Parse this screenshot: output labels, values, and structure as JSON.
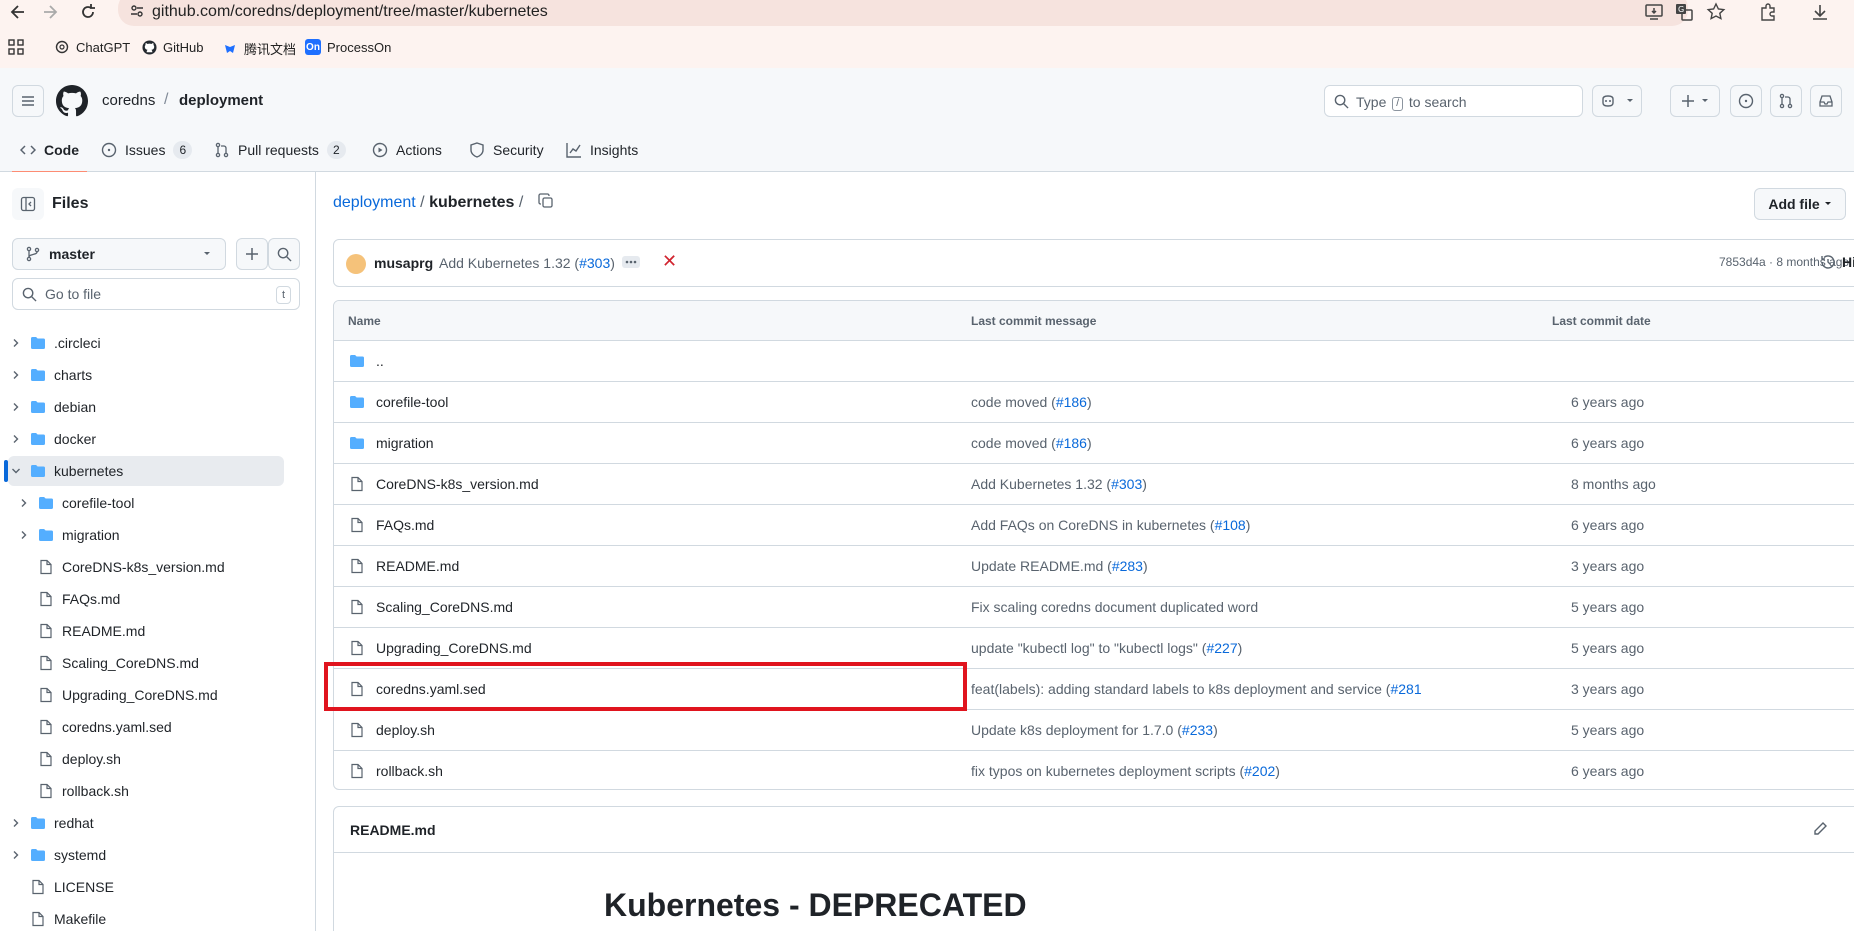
{
  "browser": {
    "url": "github.com/coredns/deployment/tree/master/kubernetes",
    "bookmarks": [
      {
        "label": "ChatGPT"
      },
      {
        "label": "GitHub"
      },
      {
        "label": "腾讯文档"
      },
      {
        "label": "ProcessOn"
      }
    ]
  },
  "header": {
    "owner": "coredns",
    "separator": "/",
    "repo": "deployment",
    "search_type": "Type",
    "search_slash": "/",
    "search_rest": "to search"
  },
  "tabs": [
    {
      "label": "Code"
    },
    {
      "label": "Issues",
      "count": "6"
    },
    {
      "label": "Pull requests",
      "count": "2"
    },
    {
      "label": "Actions"
    },
    {
      "label": "Security"
    },
    {
      "label": "Insights"
    }
  ],
  "sidebar": {
    "title": "Files",
    "branch": "master",
    "goto_placeholder": "Go to file",
    "goto_kbd": "t",
    "items": [
      {
        "label": ".circleci",
        "type": "folder"
      },
      {
        "label": "charts",
        "type": "folder"
      },
      {
        "label": "debian",
        "type": "folder"
      },
      {
        "label": "docker",
        "type": "folder"
      },
      {
        "label": "kubernetes",
        "type": "folder"
      },
      {
        "label": "corefile-tool",
        "type": "folder"
      },
      {
        "label": "migration",
        "type": "folder"
      },
      {
        "label": "CoreDNS-k8s_version.md",
        "type": "file"
      },
      {
        "label": "FAQs.md",
        "type": "file"
      },
      {
        "label": "README.md",
        "type": "file"
      },
      {
        "label": "Scaling_CoreDNS.md",
        "type": "file"
      },
      {
        "label": "Upgrading_CoreDNS.md",
        "type": "file"
      },
      {
        "label": "coredns.yaml.sed",
        "type": "file"
      },
      {
        "label": "deploy.sh",
        "type": "file"
      },
      {
        "label": "rollback.sh",
        "type": "file"
      },
      {
        "label": "redhat",
        "type": "folder"
      },
      {
        "label": "systemd",
        "type": "folder"
      },
      {
        "label": "LICENSE",
        "type": "file"
      },
      {
        "label": "Makefile",
        "type": "file"
      }
    ]
  },
  "main": {
    "path_root": "deployment",
    "path_sep": "/",
    "path_current": "kubernetes",
    "path_trailing": "/",
    "add_file": "Add file",
    "commit": {
      "author": "musaprg",
      "message": "Add Kubernetes 1.32 (",
      "pr": "#303",
      "close": ")",
      "hash_time": "7853d4a · 8 months ago",
      "history": "History"
    },
    "table_headers": {
      "name": "Name",
      "message": "Last commit message",
      "date": "Last commit date"
    },
    "parent": "..",
    "rows": [
      {
        "name": "corefile-tool",
        "type": "folder",
        "msg": "code moved (",
        "pr": "#186",
        "tail": ")",
        "date": "6 years ago"
      },
      {
        "name": "migration",
        "type": "folder",
        "msg": "code moved (",
        "pr": "#186",
        "tail": ")",
        "date": "6 years ago"
      },
      {
        "name": "CoreDNS-k8s_version.md",
        "type": "file",
        "msg": "Add Kubernetes 1.32 (",
        "pr": "#303",
        "tail": ")",
        "date": "8 months ago"
      },
      {
        "name": "FAQs.md",
        "type": "file",
        "msg": "Add FAQs on CoreDNS in kubernetes (",
        "pr": "#108",
        "tail": ")",
        "date": "6 years ago"
      },
      {
        "name": "README.md",
        "type": "file",
        "msg": "Update README.md (",
        "pr": "#283",
        "tail": ")",
        "date": "3 years ago"
      },
      {
        "name": "Scaling_CoreDNS.md",
        "type": "file",
        "msg": "Fix scaling coredns document duplicated word",
        "pr": "",
        "tail": "",
        "date": "5 years ago"
      },
      {
        "name": "Upgrading_CoreDNS.md",
        "type": "file",
        "msg": "update \"kubectl log\" to \"kubectl logs\" (",
        "pr": "#227",
        "tail": ")",
        "date": "5 years ago"
      },
      {
        "name": "coredns.yaml.sed",
        "type": "file",
        "msg": "feat(labels): adding standard labels to k8s deployment and service (",
        "pr": "#281",
        "tail": "",
        "date": "3 years ago"
      },
      {
        "name": "deploy.sh",
        "type": "file",
        "msg": "Update k8s deployment for 1.7.0 (",
        "pr": "#233",
        "tail": ")",
        "date": "5 years ago"
      },
      {
        "name": "rollback.sh",
        "type": "file",
        "msg": "fix typos on kubernetes deployment scripts (",
        "pr": "#202",
        "tail": ")",
        "date": "6 years ago"
      }
    ],
    "readme_title": "README.md",
    "readme_h1": "Kubernetes - DEPRECATED"
  }
}
